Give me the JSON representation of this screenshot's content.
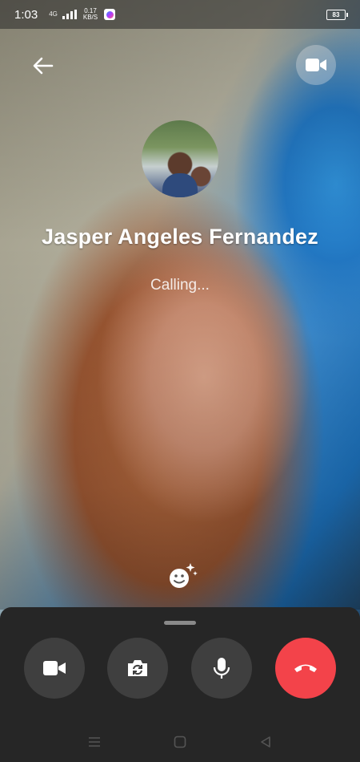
{
  "status_bar": {
    "time": "1:03",
    "network": "4G",
    "speed_value": "0.17",
    "speed_unit": "KB/S",
    "battery": "83"
  },
  "call": {
    "caller_name": "Jasper Angeles Fernandez",
    "status": "Calling..."
  },
  "icons": {
    "back": "arrow-left-icon",
    "video_top": "video-camera-icon",
    "effects": "smiley-sparkle-icon",
    "controls": [
      "video-camera-icon",
      "camera-flip-icon",
      "microphone-icon",
      "end-call-icon"
    ],
    "nav": [
      "menu-icon",
      "home-icon",
      "back-triangle-icon"
    ]
  },
  "colors": {
    "end_call": "#f3434a",
    "control_bg": "#3f3f3f",
    "panel_bg": "#262626"
  }
}
